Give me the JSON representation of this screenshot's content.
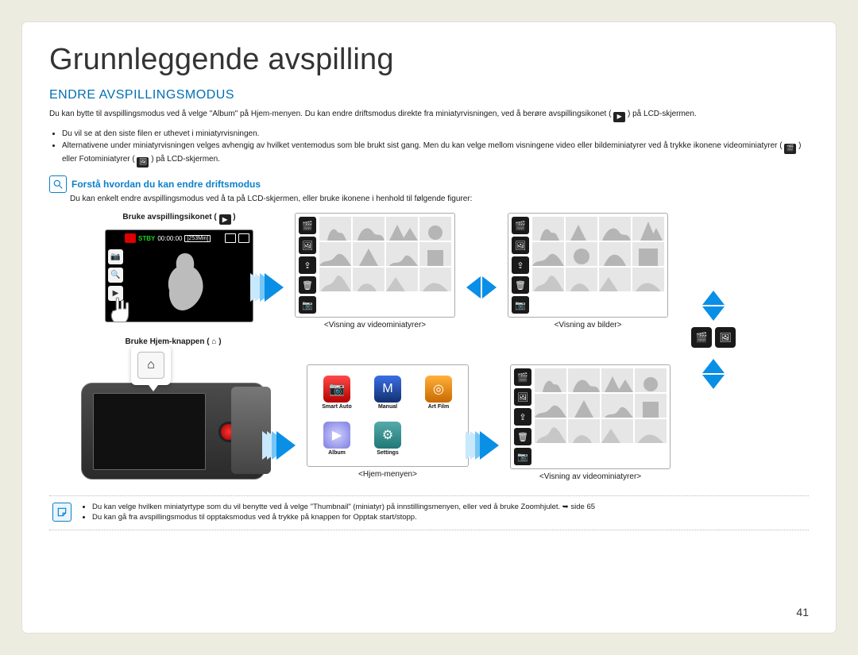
{
  "page_title": "Grunnleggende avspilling",
  "section_title": "ENDRE AVSPILLINGSMODUS",
  "intro": "Du kan bytte til avspillingsmodus ved å velge \"Album\" på Hjem-menyen. Du kan endre driftsmodus direkte fra miniatyrvisningen, ved å berøre avspillingsikonet (",
  "intro_tail": ") på LCD-skjermen.",
  "bullets": [
    "Du vil se at den siste filen er uthevet i miniatyrvisningen.",
    "Alternativene under miniatyrvisningen velges avhengig av hvilket ventemodus som ble brukt sist gang. Men du kan velge mellom visningene video eller bildeminiatyrer ved å trykke ikonene videominiatyrer (",
    ") eller Fotominiatyrer (",
    ") på LCD-skjermen."
  ],
  "sub_title": "Forstå hvordan du kan endre driftsmodus",
  "sub_desc": "Du kan enkelt endre avspillingsmodus ved å ta på LCD-skjermen, eller bruke ikonene i henhold til følgende figurer:",
  "fig1_title": "Bruke avspillingsikonet (",
  "fig1_title_tail": ")",
  "lcd": {
    "stby": "STBY",
    "time": "00:00:00",
    "mem": "[253Min]"
  },
  "caption_video_thumb": "<Visning av videominiatyrer>",
  "caption_photo_thumb": "<Visning av bilder>",
  "fig2_title": "Bruke Hjem-knappen (",
  "fig2_title_tail": ")",
  "home_menu": {
    "items": [
      {
        "label": "Smart Auto"
      },
      {
        "label": "Manual"
      },
      {
        "label": "Art Film"
      },
      {
        "label": "Album"
      },
      {
        "label": "Settings"
      }
    ],
    "caption": "<Hjem-menyen>"
  },
  "caption_video_thumb2": "<Visning av videominiatyrer>",
  "notes": [
    "Du kan velge hvilken miniatyrtype som du vil benytte ved å velge \"Thumbnail\" (miniatyr) på innstillingsmenyen, eller ved å bruke Zoomhjulet. ➥ side 65",
    "Du kan gå fra avspillingsmodus til opptaksmodus ved å trykke på knappen for Opptak start/stopp."
  ],
  "page_number": "41"
}
